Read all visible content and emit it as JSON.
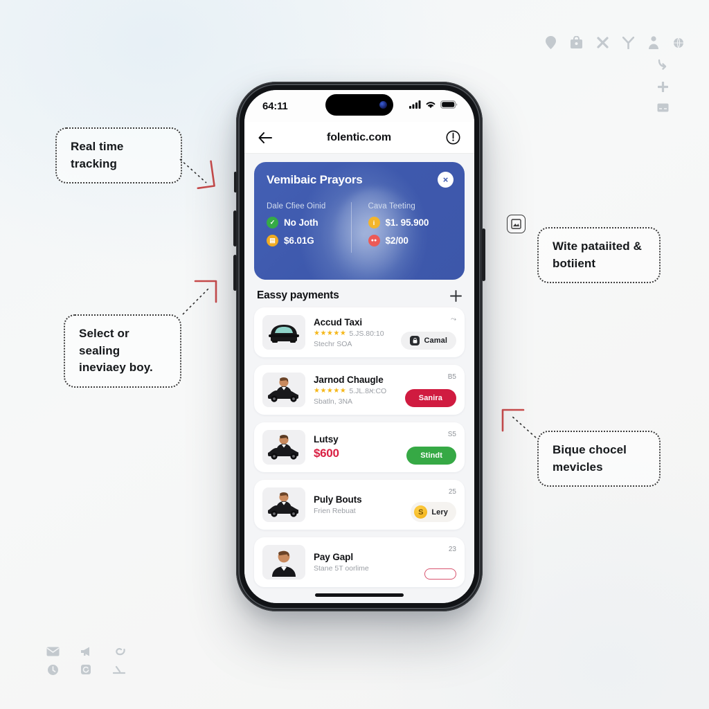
{
  "annotations": [
    {
      "id": "tracking",
      "text": "Real time tracking"
    },
    {
      "id": "select",
      "text": "Select or sealing\nineviaey boy."
    },
    {
      "id": "wite",
      "text": "Wite pataiited &\nbotiient"
    },
    {
      "id": "bique",
      "text": "Bique chocel\nmevicles"
    }
  ],
  "background_icons": {
    "top_right_row": [
      "location-pin-icon",
      "lock-bag-icon",
      "close-x-icon",
      "filter-y-icon",
      "person-icon",
      "globe-icon"
    ],
    "top_right_column": [
      "share-arrow-icon",
      "plus-icon",
      "card-icon"
    ],
    "bottom_left_grid": [
      "mail-icon",
      "megaphone-icon",
      "spiral-icon",
      "clock-icon",
      "refresh-icon",
      "pen-icon"
    ]
  },
  "phone": {
    "status_bar": {
      "time": "64:11",
      "signal_icon": "cellular-signal-icon",
      "wifi_icon": "wifi-icon",
      "battery_icon": "battery-icon"
    },
    "browser": {
      "back_icon": "back-arrow-icon",
      "url": "folentic.com",
      "info_icon": "info-circle-icon"
    },
    "banner": {
      "title": "Vemibaic Prayors",
      "close_label": "×",
      "columns": [
        {
          "label": "Dale Cfiee Oinid",
          "rows": [
            {
              "icon": "check-circle-icon",
              "color": "#35ab46",
              "glyph": "✓",
              "value": "No Joth"
            },
            {
              "icon": "wallet-circle-icon",
              "color": "#f0ab22",
              "glyph": "▤",
              "value": "$6.01G"
            }
          ]
        },
        {
          "label": "Cavа Teeting",
          "rows": [
            {
              "icon": "info-circle-icon",
              "color": "#f3b52c",
              "glyph": "i",
              "value": "$1. 95.900"
            },
            {
              "icon": "group-circle-icon",
              "color": "#ec5a56",
              "glyph": "●●",
              "value": "$2/00"
            }
          ]
        }
      ]
    },
    "section": {
      "title": "Eassy payments",
      "add_icon": "plus-icon"
    },
    "items": [
      {
        "thumb": "front-car-icon",
        "title": "Accud Taxi",
        "stars": "★★★★★",
        "rating_text": "5.JS.80:10",
        "subtitle": "Stechr SOA",
        "corner": "⤳",
        "action": {
          "label": "Camal",
          "style": "gray",
          "icon": "lock-icon"
        }
      },
      {
        "thumb": "driver-car-icon",
        "title": "Jarnod Chaugle",
        "stars": "★★★★★",
        "rating_text": "5.JL.8א:CO",
        "subtitle": "Sbatln, 3NA",
        "corner": "B5",
        "action": {
          "label": "Sanira",
          "style": "red"
        }
      },
      {
        "thumb": "driver-car-icon",
        "title": "Lutsy",
        "price": "$600",
        "corner": "S5",
        "action": {
          "label": "Stindt",
          "style": "green"
        }
      },
      {
        "thumb": "driver-car-icon",
        "title": "Puly Bouts",
        "subtitle": "Frien Rebuat",
        "corner": "25",
        "action": {
          "label": "Lery",
          "style": "light",
          "icon": "coin-icon"
        }
      },
      {
        "thumb": "driver-portrait-icon",
        "title": "Pay Gapl",
        "subtitle": "Stane 5T oorlime",
        "corner": "23",
        "action": {
          "label": "",
          "style": "outline"
        }
      }
    ]
  }
}
